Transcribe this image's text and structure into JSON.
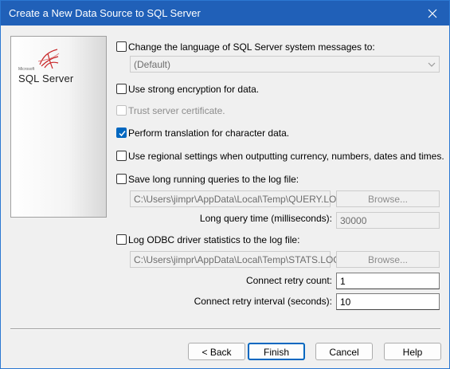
{
  "window": {
    "title": "Create a New Data Source to SQL Server"
  },
  "logo": {
    "brand": "Microsoft",
    "product": "SQL Server"
  },
  "options": {
    "change_language": {
      "label": "Change the language of SQL Server system messages to:",
      "checked": false
    },
    "language_select": {
      "value": "(Default)"
    },
    "strong_encryption": {
      "label": "Use strong encryption for data.",
      "checked": false
    },
    "trust_cert": {
      "label": "Trust server certificate.",
      "checked": false,
      "disabled": true
    },
    "translation": {
      "label": "Perform translation for character data.",
      "checked": true
    },
    "regional": {
      "label": "Use regional settings when outputting currency, numbers, dates and times.",
      "checked": false
    },
    "long_queries": {
      "label": "Save long running queries to the log file:",
      "checked": false
    },
    "query_log_path": "C:\\Users\\jimpr\\AppData\\Local\\Temp\\QUERY.LOG",
    "long_query_time_label": "Long query time (milliseconds):",
    "long_query_time": "30000",
    "odbc_stats": {
      "label": "Log ODBC driver statistics to the log file:",
      "checked": false
    },
    "stats_log_path": "C:\\Users\\jimpr\\AppData\\Local\\Temp\\STATS.LOG",
    "browse_label": "Browse...",
    "retry_count_label": "Connect retry count:",
    "retry_count": "1",
    "retry_interval_label": "Connect retry interval (seconds):",
    "retry_interval": "10"
  },
  "buttons": {
    "back": "< Back",
    "finish": "Finish",
    "cancel": "Cancel",
    "help": "Help"
  },
  "colors": {
    "titlebar": "#2060b8",
    "accent": "#0067c0",
    "logo_red": "#c8282a"
  }
}
